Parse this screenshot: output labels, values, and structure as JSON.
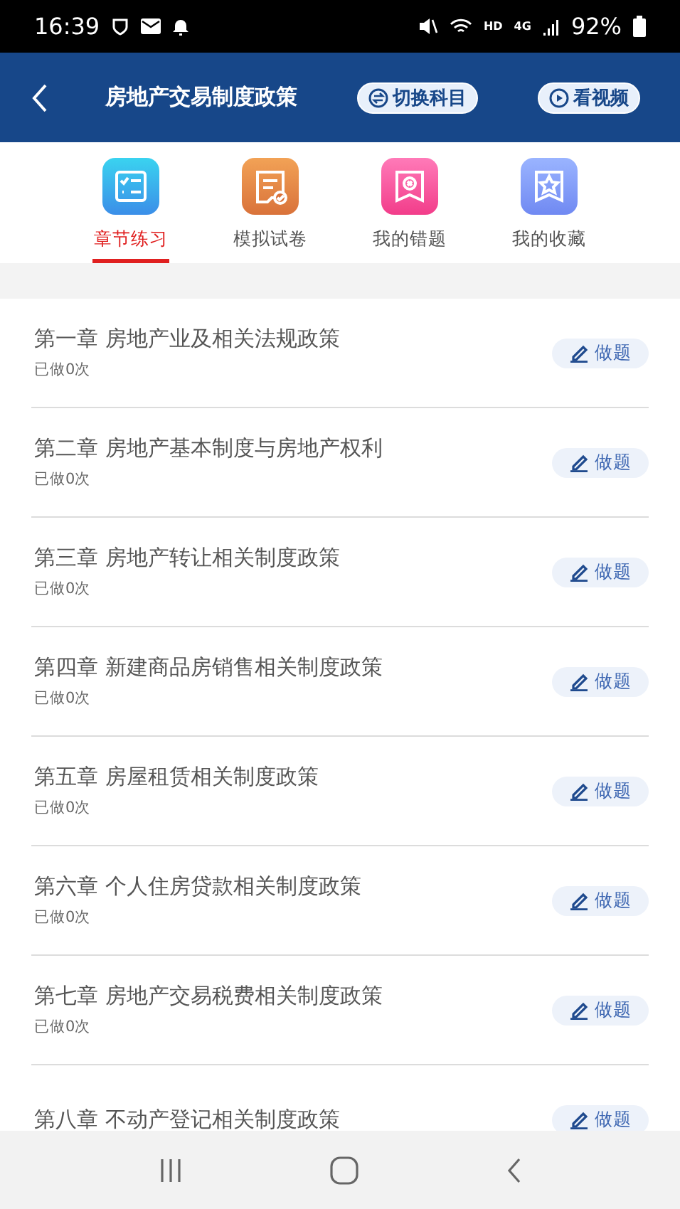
{
  "status_bar": {
    "time": "16:39",
    "battery": "92%",
    "network": "4G",
    "hd": "HD"
  },
  "header": {
    "title": "房地产交易制度政策",
    "buttons": [
      {
        "kind": "switch",
        "label": "切换科目"
      },
      {
        "kind": "video",
        "label": "看视频"
      }
    ]
  },
  "tabs": [
    {
      "kind": "list",
      "label": "章节练习",
      "selected": true
    },
    {
      "kind": "paper",
      "label": "模拟试卷",
      "selected": false
    },
    {
      "kind": "wrong",
      "label": "我的错题",
      "selected": false
    },
    {
      "kind": "star",
      "label": "我的收藏",
      "selected": false
    }
  ],
  "chapters": [
    {
      "title": "第一章 房地产业及相关法规政策",
      "count": "已做0次",
      "action": "做题"
    },
    {
      "title": "第二章 房地产基本制度与房地产权利",
      "count": "已做0次",
      "action": "做题"
    },
    {
      "title": "第三章 房地产转让相关制度政策",
      "count": "已做0次",
      "action": "做题"
    },
    {
      "title": "第四章 新建商品房销售相关制度政策",
      "count": "已做0次",
      "action": "做题"
    },
    {
      "title": "第五章 房屋租赁相关制度政策",
      "count": "已做0次",
      "action": "做题"
    },
    {
      "title": "第六章 个人住房贷款相关制度政策",
      "count": "已做0次",
      "action": "做题"
    },
    {
      "title": "第七章 房地产交易税费相关制度政策",
      "count": "已做0次",
      "action": "做题"
    },
    {
      "title": "第八章 不动产登记相关制度政策",
      "action": "做题"
    }
  ]
}
